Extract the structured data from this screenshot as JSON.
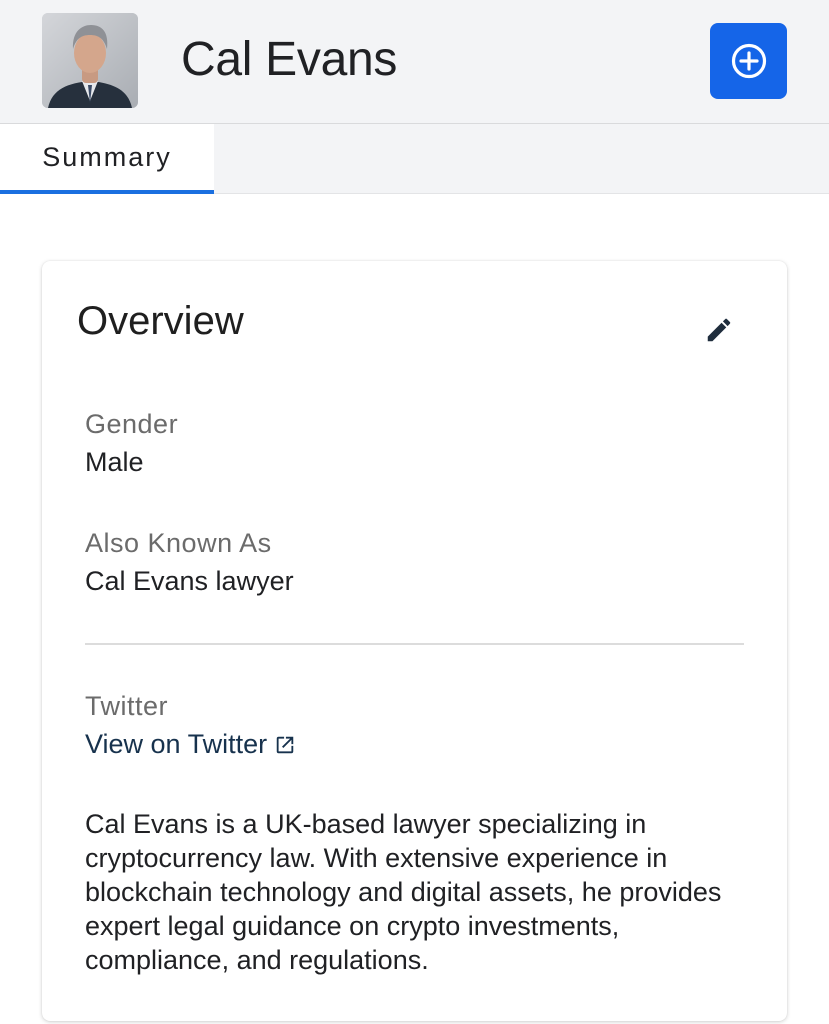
{
  "header": {
    "name": "Cal Evans",
    "add_button_icon": "plus-circle-icon",
    "accent_color": "#1565e8"
  },
  "tabs": [
    {
      "label": "Summary",
      "active": true
    }
  ],
  "overview": {
    "title": "Overview",
    "edit_icon": "pencil-icon",
    "fields": {
      "gender": {
        "label": "Gender",
        "value": "Male"
      },
      "aka": {
        "label": "Also Known As",
        "value": "Cal Evans lawyer"
      },
      "twitter": {
        "label": "Twitter",
        "link_text": "View on Twitter",
        "link_icon": "external-link-icon"
      }
    },
    "description": "Cal Evans is a UK-based lawyer specializing in cryptocurrency law. With extensive experience in blockchain technology and digital assets, he provides expert legal guidance on crypto investments, compliance, and regulations."
  }
}
